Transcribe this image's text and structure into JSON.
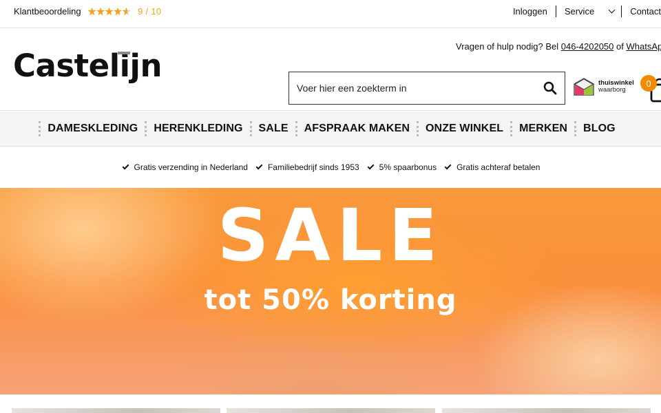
{
  "topbar": {
    "rating_label": "Klantbeoordeling",
    "rating_score": "9 / 10",
    "rating_stars": 4.5,
    "login": "Inloggen",
    "service": "Service",
    "contact": "Contact"
  },
  "header": {
    "logo": "Castelijn",
    "help_text": "Vragen of hulp nodig? Bel",
    "phone": "046-4202050",
    "or": "of",
    "whatsapp": "WhatsApp",
    "search_placeholder": "Voer hier een zoekterm in",
    "thuiswinkel_line1": "thuiswinkel",
    "thuiswinkel_line2": "waarborg",
    "cart_count": "0"
  },
  "nav": {
    "items": [
      "DAMESKLEDING",
      "HERENKLEDING",
      "SALE",
      "AFSPRAAK MAKEN",
      "ONZE WINKEL",
      "MERKEN",
      "BLOG"
    ]
  },
  "usps": [
    "Gratis verzending in Nederland",
    "Familiebedrijf sinds 1953",
    "5% spaarbonus",
    "Gratis achteraf betalen"
  ],
  "banner": {
    "title": "SALE",
    "subtitle": "tot 50% korting"
  },
  "colors": {
    "accent": "#f28b00",
    "star": "#f2a31b",
    "banner_orange": "#f99a3a"
  }
}
